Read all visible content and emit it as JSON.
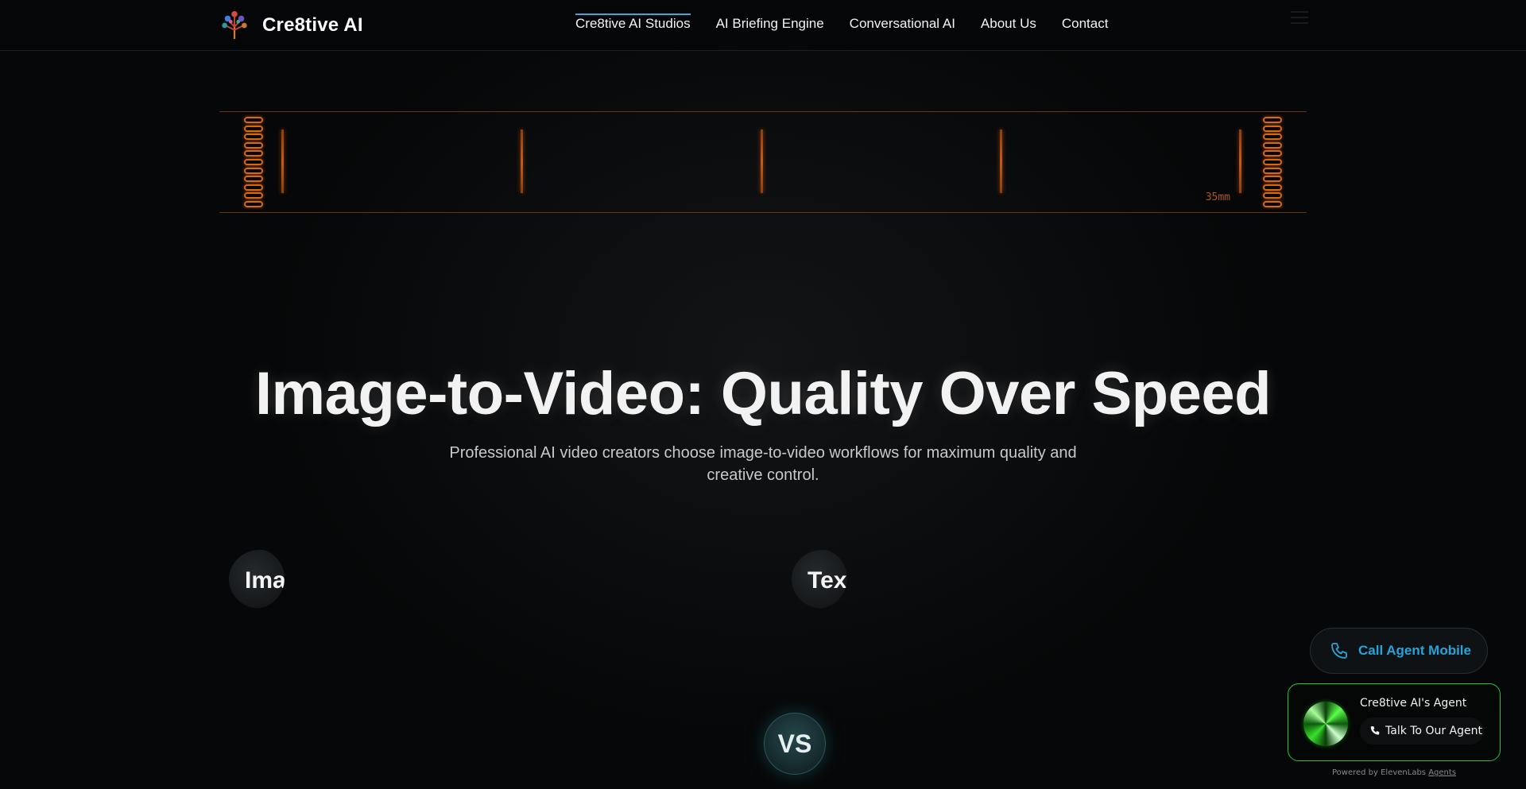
{
  "brand": {
    "name": "Cre8tive AI",
    "logo_icon": "tree-logo-icon"
  },
  "nav": {
    "links": [
      {
        "label": "Cre8tive AI Studios",
        "active": true
      },
      {
        "label": "AI Briefing Engine",
        "active": false
      },
      {
        "label": "Conversational AI",
        "active": false
      },
      {
        "label": "About Us",
        "active": false
      },
      {
        "label": "Contact",
        "active": false
      }
    ],
    "accent": "#38a9d8"
  },
  "film_strip": {
    "label": "35mm",
    "accent": "#d9680f"
  },
  "hero": {
    "title": "Image-to-Video: Quality Over Speed",
    "subtitle": "Professional AI video creators choose image-to-video workflows for maximum quality and creative control."
  },
  "compare": {
    "left_label": "Ima",
    "right_label": "Tex",
    "vs_label": "VS"
  },
  "call_widget": {
    "label": "Call Agent Mobile",
    "icon": "phone-icon",
    "color": "#26a4d8"
  },
  "agent_widget": {
    "name": "Cre8tive AI's Agent",
    "button_label": "Talk To Our Agent",
    "border_color": "#20c83a",
    "powered_prefix": "Powered by ElevenLabs",
    "powered_link": "Agents"
  }
}
